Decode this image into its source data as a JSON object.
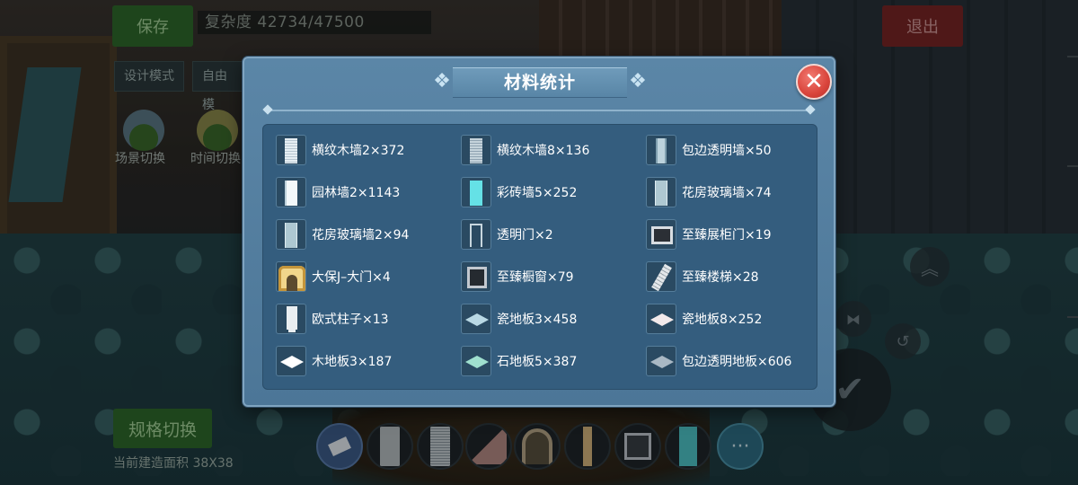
{
  "hud": {
    "save_label": "保存",
    "complexity_text": "复杂度 42734/47500",
    "exit_label": "退出",
    "mode_design_label": "设计模式",
    "mode_free_label": "自由模",
    "scene_switch_label": "场景切换",
    "time_switch_label": "时间切换",
    "spec_switch_label": "规格切换",
    "build_area_label": "当前建造面积 38X38"
  },
  "dialog": {
    "title": "材料统计",
    "close_icon": "close-icon",
    "items": [
      {
        "label": "横纹木墙2×372",
        "icon": "striped-wall-icon"
      },
      {
        "label": "横纹木墙8×136",
        "icon": "striped-wall-icon"
      },
      {
        "label": "包边透明墙×50",
        "icon": "glass-wall-icon"
      },
      {
        "label": "园林墙2×1143",
        "icon": "garden-wall-icon"
      },
      {
        "label": "彩砖墙5×252",
        "icon": "colored-brick-wall-icon"
      },
      {
        "label": "花房玻璃墙×74",
        "icon": "greenhouse-glass-wall-icon"
      },
      {
        "label": "花房玻璃墙2×94",
        "icon": "greenhouse-glass-wall-icon"
      },
      {
        "label": "透明门×2",
        "icon": "transparent-door-icon"
      },
      {
        "label": "至臻展柜门×19",
        "icon": "display-cabinet-door-icon"
      },
      {
        "label": "大保J–大门×4",
        "icon": "gate-icon"
      },
      {
        "label": "至臻橱窗×79",
        "icon": "showcase-window-icon"
      },
      {
        "label": "至臻楼梯×28",
        "icon": "staircase-icon"
      },
      {
        "label": "欧式柱子×13",
        "icon": "european-column-icon"
      },
      {
        "label": "瓷地板3×458",
        "icon": "ceramic-floor-icon"
      },
      {
        "label": "瓷地板8×252",
        "icon": "ceramic-floor-icon"
      },
      {
        "label": "木地板3×187",
        "icon": "wood-floor-icon"
      },
      {
        "label": "石地板5×387",
        "icon": "stone-floor-icon"
      },
      {
        "label": "包边透明地板×606",
        "icon": "transparent-floor-icon"
      }
    ]
  },
  "toolbar": {
    "tools": [
      "eraser-icon",
      "wall-icon",
      "striped-wall-icon",
      "staircase-icon",
      "arch-door-icon",
      "column-icon",
      "showcase-window-icon",
      "cyan-wall-icon",
      "more-icon"
    ],
    "more_label": "···"
  },
  "colors": {
    "dialog_bg": "#5b86a7",
    "panel_bg": "#345d7e",
    "close_red": "#d9443b",
    "save_green": "#2f6b2c",
    "exit_red": "#7a2626"
  }
}
